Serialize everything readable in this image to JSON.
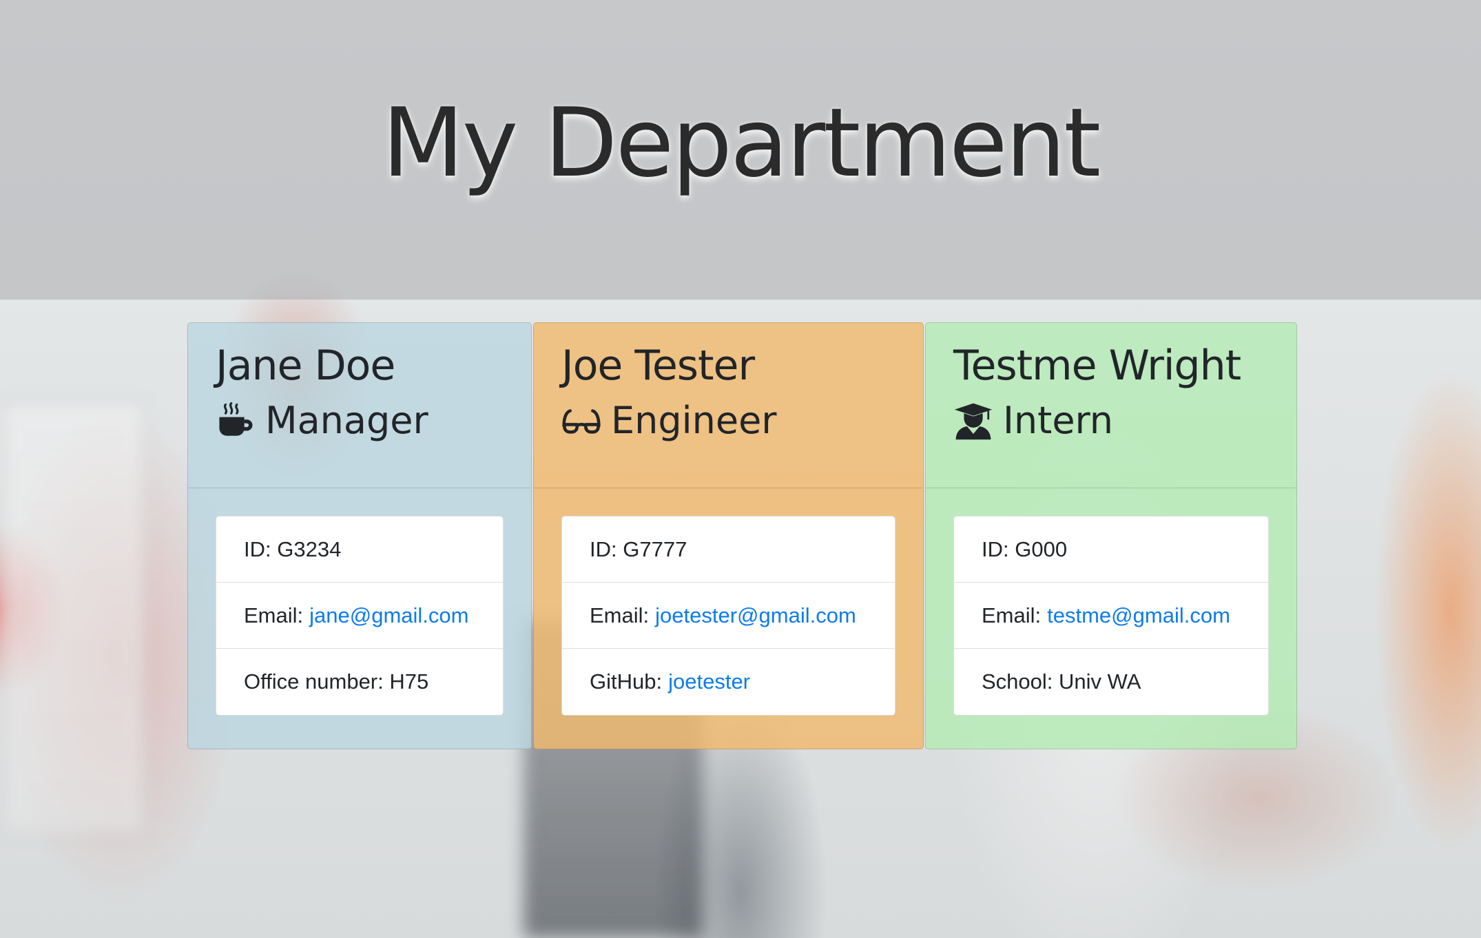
{
  "header": {
    "title": "My Department"
  },
  "team": [
    {
      "name": "Jane Doe",
      "role": "Manager",
      "icon": "coffee-icon",
      "id_label": "ID:",
      "id_value": "G3234",
      "email_label": "Email:",
      "email": "jane@gmail.com",
      "extra_label": "Office number:",
      "extra_value": "H75",
      "color": "#bad6e0"
    },
    {
      "name": "Joe Tester",
      "role": "Engineer",
      "icon": "glasses-icon",
      "id_label": "ID:",
      "id_value": "G7777",
      "email_label": "Email:",
      "email": "joetester@gmail.com",
      "extra_label": "GitHub:",
      "extra_value": "joetester",
      "color": "#f0ba6e"
    },
    {
      "name": "Testme Wright",
      "role": "Intern",
      "icon": "graduate-icon",
      "id_label": "ID:",
      "id_value": "G000",
      "email_label": "Email:",
      "email": "testme@gmail.com",
      "extra_label": "School:",
      "extra_value": "Univ WA",
      "color": "#b2ecb2"
    }
  ],
  "colors": {
    "link": "#0d7bef",
    "text": "#212529"
  }
}
